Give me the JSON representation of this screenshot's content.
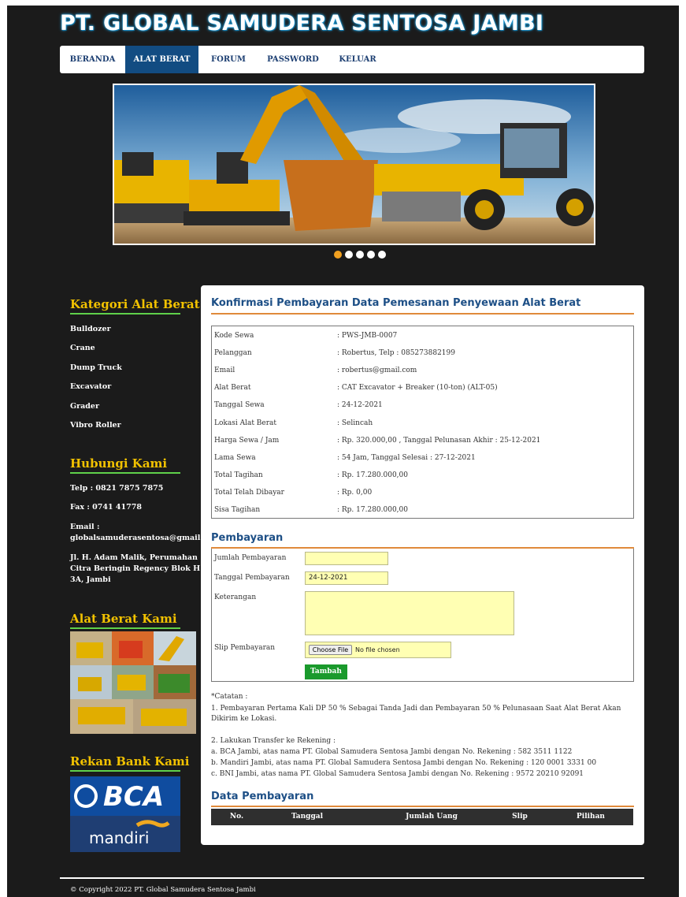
{
  "header": {
    "title": "PT. GLOBAL SAMUDERA SENTOSA JAMBI"
  },
  "nav": {
    "items": [
      {
        "label": "BERANDA",
        "active": false
      },
      {
        "label": "ALAT BERAT",
        "active": true
      },
      {
        "label": "FORUM",
        "active": false
      },
      {
        "label": "PASSWORD",
        "active": false
      },
      {
        "label": "KELUAR",
        "active": false
      }
    ]
  },
  "slider": {
    "dot_count": 5,
    "active_index": 0
  },
  "sidebar": {
    "kategori": {
      "title": "Kategori Alat Berat",
      "items": [
        "Bulldozer",
        "Crane",
        "Dump Truck",
        "Excavator",
        "Grader",
        "Vibro Roller"
      ]
    },
    "hubungi": {
      "title": "Hubungi Kami",
      "telp": "Telp : 0821 7875 7875",
      "fax": "Fax : 0741 41778",
      "email_label": "Email :",
      "email": "globalsamuderasentosa@gmail.com",
      "address_1": "Jl. H. Adam Malik, Perumahan",
      "address_2": "Citra Beringin Regency Blok H",
      "address_3": "3A, Jambi"
    },
    "alat": {
      "title": "Alat Berat Kami"
    },
    "bank": {
      "title": "Rekan Bank Kami",
      "bca": "BCA",
      "mandiri": "mandiri"
    }
  },
  "main": {
    "title": "Konfirmasi Pembayaran Data Pemesanan Penyewaan Alat Berat",
    "info": [
      {
        "label": "Kode Sewa",
        "value": ": PWS-JMB-0007"
      },
      {
        "label": "Pelanggan",
        "value": ": Robertus, Telp : 085273882199"
      },
      {
        "label": "Email",
        "value": ": robertus@gmail.com"
      },
      {
        "label": "Alat Berat",
        "value": ": CAT Excavator + Breaker (10-ton) (ALT-05)"
      },
      {
        "label": "Tanggal Sewa",
        "value": ": 24-12-2021"
      },
      {
        "label": "Lokasi Alat Berat",
        "value": ": Selincah"
      },
      {
        "label": "Harga Sewa / Jam",
        "value": ": Rp. 320.000,00 , Tanggal Pelunasan Akhir : 25-12-2021"
      },
      {
        "label": "Lama Sewa",
        "value": ": 54 Jam, Tanggal Selesai : 27-12-2021"
      },
      {
        "label": "Total Tagihan",
        "value": ": Rp. 17.280.000,00"
      },
      {
        "label": "Total Telah Dibayar",
        "value": ": Rp. 0,00"
      },
      {
        "label": "Sisa Tagihan",
        "value": ": Rp. 17.280.000,00"
      }
    ],
    "pembayaran": {
      "title": "Pembayaran",
      "jumlah_label": "Jumlah Pembayaran",
      "jumlah_value": "",
      "tanggal_label": "Tanggal Pembayaran",
      "tanggal_value": "24-12-2021",
      "keterangan_label": "Keterangan",
      "keterangan_value": "",
      "slip_label": "Slip Pembayaran",
      "file_button": "Choose File",
      "file_status": "No file chosen",
      "submit": "Tambah"
    },
    "notes": {
      "catatan": "*Catatan :",
      "point1": "1. Pembayaran Pertama Kali DP 50 % Sebagai Tanda Jadi dan Pembayaran 50 % Pelunasaan Saat Alat Berat Akan Dikirim ke Lokasi.",
      "point2": "2. Lakukan Transfer ke Rekening :",
      "bank_a": "a. BCA Jambi, atas nama PT. Global Samudera Sentosa Jambi dengan No. Rekening : 582 3511 1122",
      "bank_b": "b. Mandiri Jambi, atas nama PT. Global Samudera Sentosa Jambi dengan No. Rekening : 120 0001 3331 00",
      "bank_c": "c. BNI Jambi, atas nama PT. Global Samudera Sentosa Jambi dengan No. Rekening : 9572 20210 92091"
    },
    "data_pembayaran": {
      "title": "Data Pembayaran",
      "columns": [
        "No.",
        "Tanggal",
        "Jumlah Uang",
        "Slip",
        "Pilihan"
      ]
    }
  },
  "footer": {
    "copyright": "© Copyright 2022 PT. Global Samudera Sentosa Jambi"
  },
  "colors": {
    "nav_active": "#124c82",
    "accent_orange": "#e08a3b",
    "sidebar_heading": "#f2c200",
    "sidebar_underline": "#5fd14a",
    "button_green": "#1a9a2c",
    "field_yellow": "#ffffb3"
  }
}
